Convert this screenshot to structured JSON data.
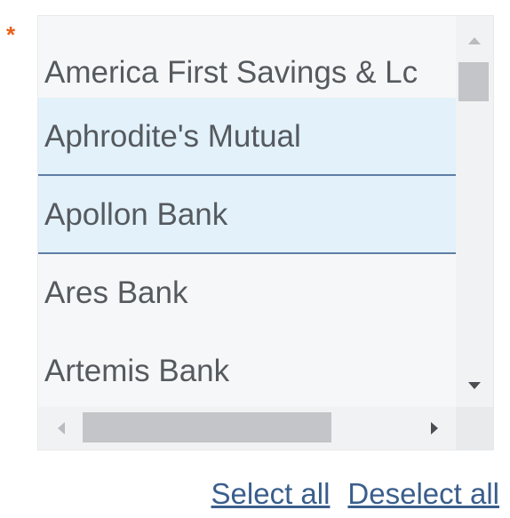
{
  "required_marker": "*",
  "listbox": {
    "items": [
      {
        "label": "America First Savings & Lc",
        "selected": false
      },
      {
        "label": "Aphrodite's Mutual",
        "selected": true
      },
      {
        "label": "Apollon Bank",
        "selected": true
      },
      {
        "label": "Ares Bank",
        "selected": false
      },
      {
        "label": "Artemis Bank",
        "selected": false
      }
    ]
  },
  "actions": {
    "select_all": "Select all",
    "deselect_all": "Deselect all"
  },
  "colors": {
    "required": "#e8601a",
    "selected_bg": "#e2f1fa",
    "selected_border": "#5f7da5",
    "link": "#3a5e8c",
    "item_text": "#555a5f"
  }
}
